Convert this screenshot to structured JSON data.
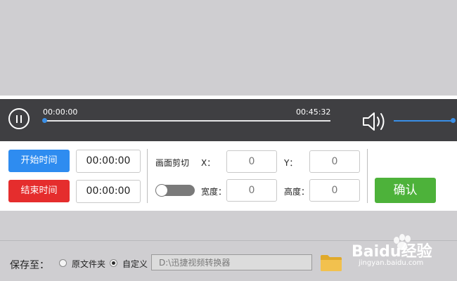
{
  "player": {
    "current_time": "00:00:00",
    "total_time": "00:45:32",
    "progress": 0.0,
    "volume": 1.0
  },
  "trim": {
    "start_button": "开始时间",
    "end_button": "结束时间",
    "start_value": "00:00:00",
    "end_value": "00:00:00"
  },
  "crop": {
    "label": "画面剪切",
    "x_label": "X：",
    "y_label": "Y：",
    "width_label": "宽度：",
    "height_label": "高度：",
    "x_value": "0",
    "y_value": "0",
    "width_value": "0",
    "height_value": "0",
    "enabled": false
  },
  "confirm_button": "确认",
  "footer": {
    "save_to_label": "保存至：",
    "option_original": "原文件夹",
    "option_custom": "自定义",
    "selected": "custom",
    "path_value": "D:\\迅捷视频转换器"
  },
  "watermark": {
    "brand": "Baidu经验",
    "url": "jingyan.baidu.com"
  },
  "colors": {
    "start_button": "#2e8cf0",
    "end_button": "#e52d2d",
    "confirm_button": "#4db23a",
    "accent": "#3a8fe6",
    "player_bar": "#3f3f42"
  },
  "icons": [
    "pause-icon",
    "volume-icon",
    "folder-icon"
  ]
}
